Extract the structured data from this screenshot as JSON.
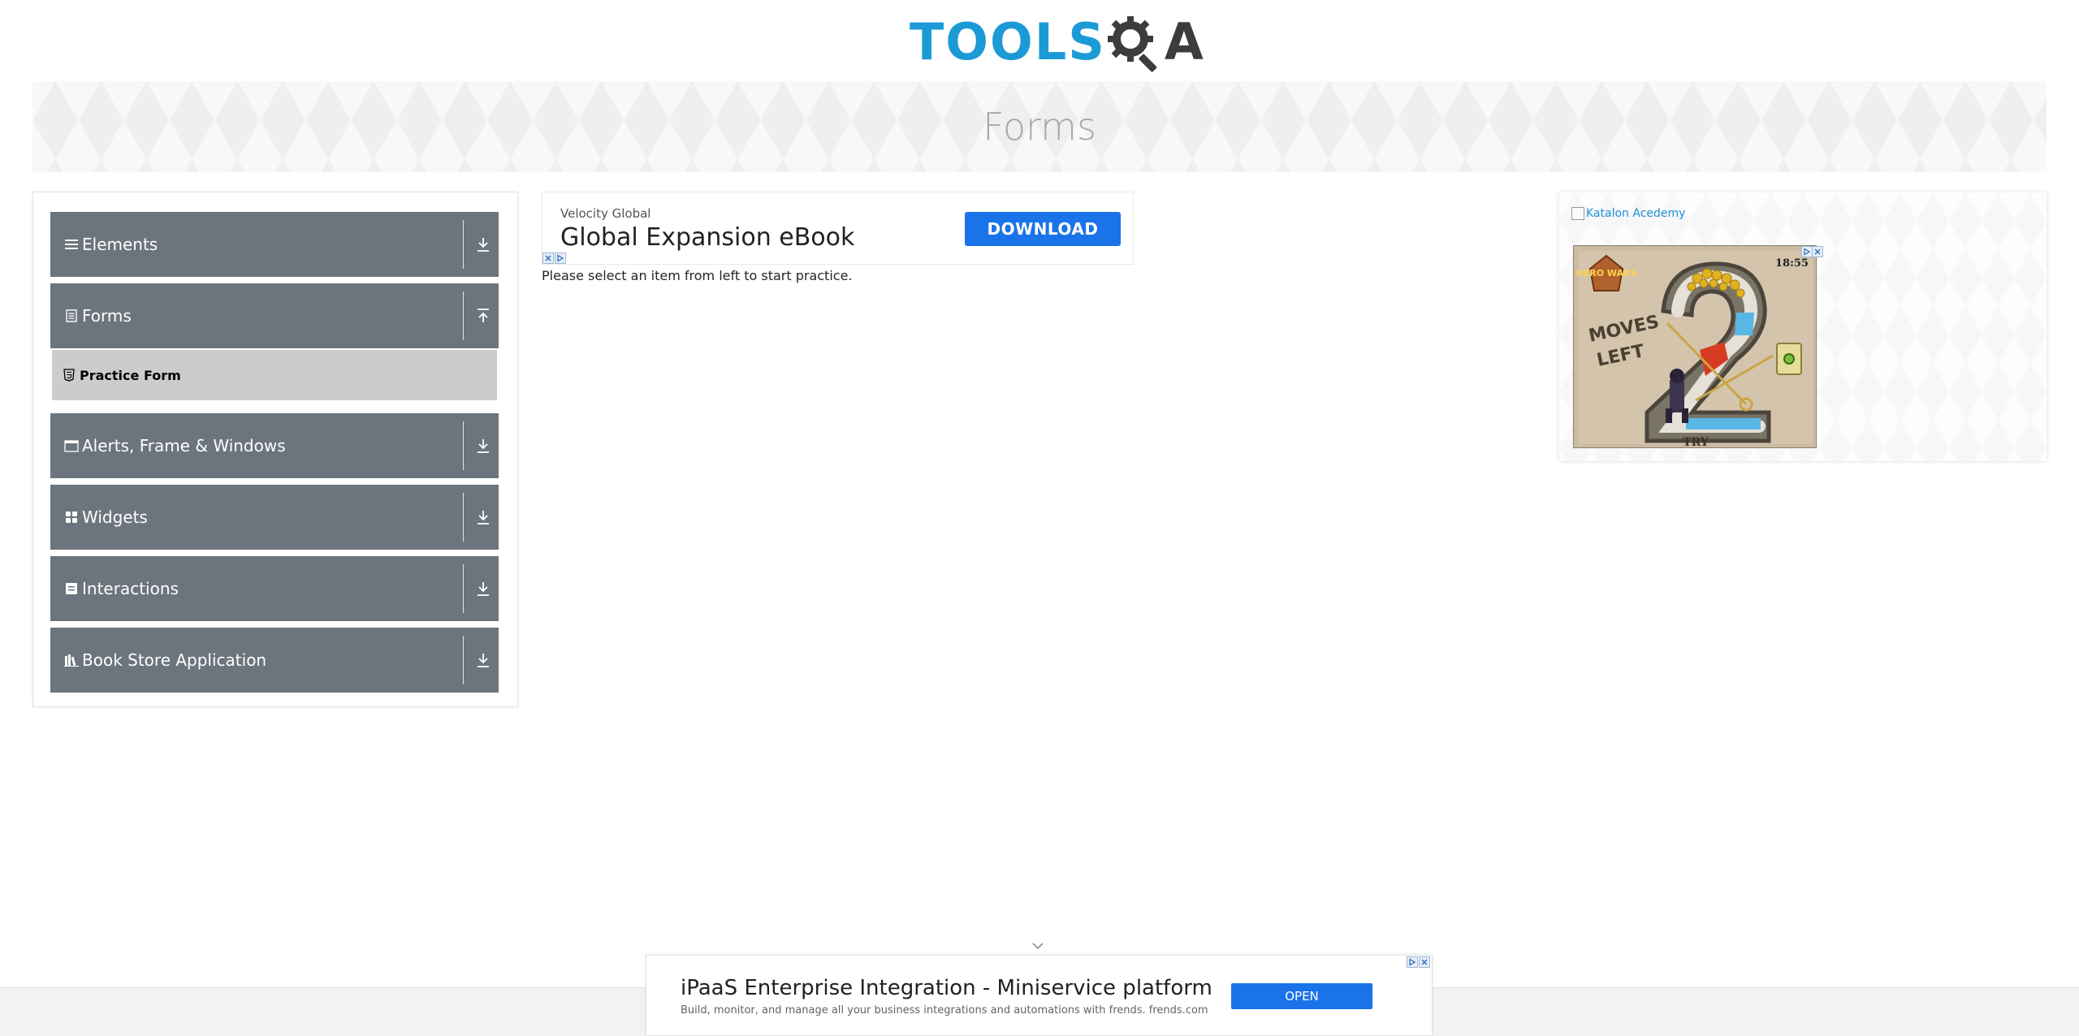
{
  "header": {
    "logo_word": "TOOLS",
    "logo_qa": "A",
    "logo_colors": {
      "tools": "#1c9ad6",
      "qa": "#3c3c3c"
    }
  },
  "banner": {
    "title": "Forms"
  },
  "sidebar": {
    "groups": [
      {
        "label": "Elements",
        "icon": "hamburger-icon",
        "toggle": "download-icon",
        "expanded": false
      },
      {
        "label": "Forms",
        "icon": "document-icon",
        "toggle": "upload-icon",
        "expanded": true
      },
      {
        "label": "Alerts, Frame & Windows",
        "icon": "window-icon",
        "toggle": "download-icon",
        "expanded": false
      },
      {
        "label": "Widgets",
        "icon": "grid-icon",
        "toggle": "download-icon",
        "expanded": false
      },
      {
        "label": "Interactions",
        "icon": "interaction-icon",
        "toggle": "download-icon",
        "expanded": false
      },
      {
        "label": "Book Store Application",
        "icon": "books-icon",
        "toggle": "download-icon",
        "expanded": false
      }
    ],
    "subitems": [
      {
        "label": "Practice Form",
        "icon": "html5-icon"
      }
    ],
    "colors": {
      "group_bg": "#6c757d",
      "subitem_bg": "#cccccc"
    }
  },
  "ad_top": {
    "advertiser": "Velocity Global",
    "headline": "Global Expansion eBook",
    "cta": "DOWNLOAD"
  },
  "main": {
    "instruction": "Please select an item from left to start practice."
  },
  "right_ad": {
    "link_alt": "Katalon Acedemy",
    "game": {
      "brand": "HERO WARS",
      "caption_line1": "MOVES",
      "caption_line2": "LEFT",
      "big_number": "2",
      "time": "18:55",
      "button": "TRY"
    }
  },
  "bottom_ad": {
    "title": "iPaaS Enterprise Integration - Miniservice platform",
    "description": "Build, monitor, and manage all your business integrations and automations with frends. frends.com",
    "cta": "OPEN"
  }
}
